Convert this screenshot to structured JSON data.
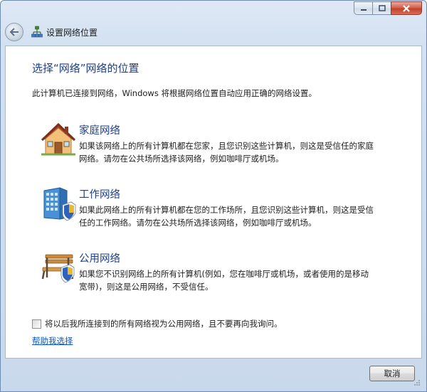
{
  "window": {
    "title": "设置网络位置",
    "controls": {
      "minimize": "minimize",
      "maximize": "maximize",
      "close": "close"
    }
  },
  "main": {
    "heading": "选择“网络”网络的位置",
    "intro": "此计算机已连接到网络，Windows 将根据网络位置自动应用正确的网络设置。",
    "options": [
      {
        "title": "家庭网络",
        "description": "如果该网络上的所有计算机都在您家，且您识别这些计算机，则这是受信任的家庭网络。请勿在公共场所选择该网络，例如咖啡厅或机场。",
        "icon": "house-icon"
      },
      {
        "title": "工作网络",
        "description": "如果此网络上的所有计算机都在您的工作场所，且您识别这些计算机，则这是受信任的工作网络。请勿在公共场所选择该网络，例如咖啡厅或机场。",
        "icon": "office-building-icon"
      },
      {
        "title": "公用网络",
        "description": "如果您不识别网络上的所有计算机(例如，您在咖啡厅或机场，或者使用的是移动宽带)，则这是公用网络，不受信任。",
        "icon": "park-bench-icon"
      }
    ],
    "checkbox": {
      "label": "将以后我所连接到的所有网络视为公用网络，且不要再向我询问。",
      "checked": false
    },
    "help_link": "帮助我选择"
  },
  "footer": {
    "cancel_label": "取消"
  },
  "colors": {
    "heading": "#1e3f8a",
    "link": "#0d55c5",
    "frame": "#d3e1f1",
    "close_button": "#c4402a"
  }
}
